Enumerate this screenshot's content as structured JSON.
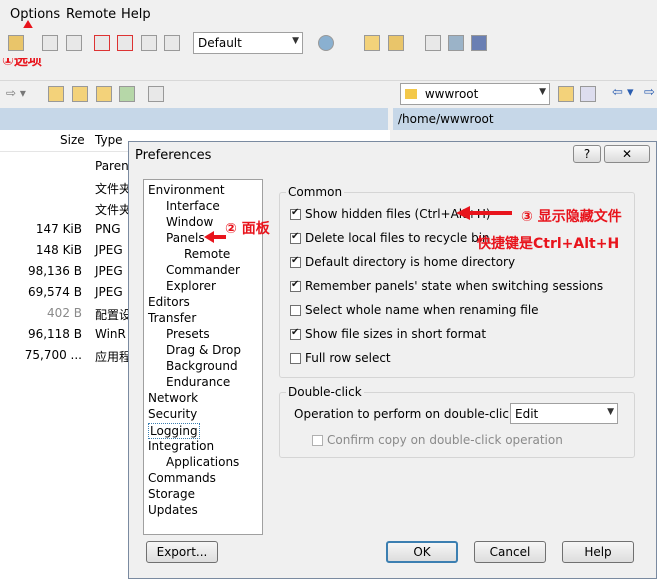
{
  "menu": {
    "options": "Options",
    "remote": "Remote",
    "help": "Help"
  },
  "toolbar": {
    "session_value": "Default"
  },
  "nav": {
    "remote_dir": "wwwroot"
  },
  "remote_path": "/home/wwwroot",
  "file_list": {
    "col_size": "Size",
    "col_type": "Type",
    "rows": [
      {
        "size": "",
        "type": "Paren"
      },
      {
        "size": "",
        "type": "文件夹"
      },
      {
        "size": "",
        "type": "文件夹"
      },
      {
        "size": "147 KiB",
        "type": "PNG"
      },
      {
        "size": "148 KiB",
        "type": "JPEG"
      },
      {
        "size": "98,136 B",
        "type": "JPEG"
      },
      {
        "size": "69,574 B",
        "type": "JPEG"
      },
      {
        "size": "402 B",
        "type": "配置设"
      },
      {
        "size": "96,118 B",
        "type": "WinR"
      },
      {
        "size": "75,700 ...",
        "type": "应用程"
      }
    ]
  },
  "annotations": {
    "a1": "①选项",
    "a2": "② 面板",
    "a3": "③ 显示隐藏文件",
    "a3b": "快捷键是Ctrl+Alt+H"
  },
  "dialog": {
    "title": "Preferences",
    "help_btn": "?",
    "close_btn": "✕",
    "tree": [
      "Environment",
      "Interface",
      "Window",
      "Panels",
      "Remote",
      "Commander",
      "Explorer",
      "Editors",
      "Transfer",
      "Presets",
      "Drag & Drop",
      "Background",
      "Endurance",
      "Network",
      "Security",
      "Logging",
      "Integration",
      "Applications",
      "Commands",
      "Storage",
      "Updates"
    ],
    "common_title": "Common",
    "options": [
      {
        "label": "Show hidden files (Ctrl+Alt+H)",
        "checked": true
      },
      {
        "label": "Delete local files to recycle bin",
        "checked": true
      },
      {
        "label": "Default directory is home directory",
        "checked": true
      },
      {
        "label": "Remember panels' state when switching sessions",
        "checked": true
      },
      {
        "label": "Select whole name when renaming file",
        "checked": false
      },
      {
        "label": "Show file sizes in short format",
        "checked": true
      },
      {
        "label": "Full row select",
        "checked": false
      }
    ],
    "dblclick_title": "Double-click",
    "dblclick_label": "Operation to perform on double-click:",
    "dblclick_value": "Edit",
    "confirm_copy": "Confirm copy on double-click operation",
    "export_btn": "Export...",
    "ok_btn": "OK",
    "cancel_btn": "Cancel",
    "help_bottom": "Help"
  },
  "colors": {
    "accent": "#e8141c",
    "focus": "#3c7fb1"
  }
}
